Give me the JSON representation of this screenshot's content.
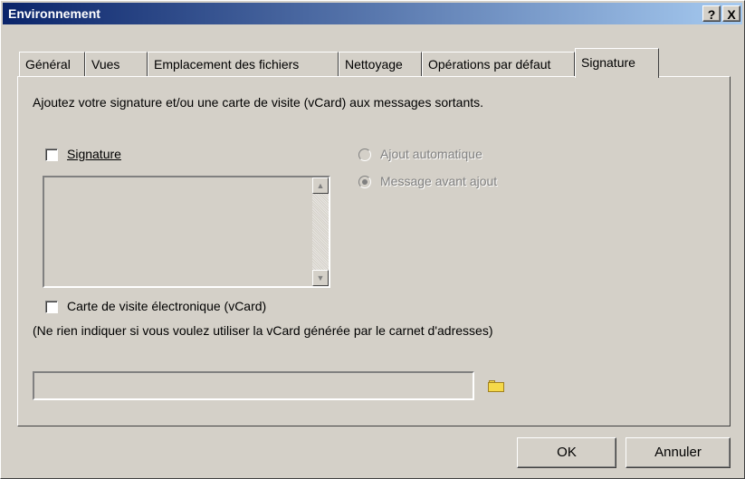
{
  "window": {
    "title": "Environnement",
    "help_label": "?",
    "close_label": "X"
  },
  "tabs": [
    {
      "label": "Général"
    },
    {
      "label": "Vues"
    },
    {
      "label": "Emplacement des fichiers"
    },
    {
      "label": "Nettoyage"
    },
    {
      "label": "Opérations par défaut"
    },
    {
      "label": "Signature"
    }
  ],
  "active_tab": "Signature",
  "signature_panel": {
    "description": "Ajoutez votre signature et/ou une carte de visite (vCard) aux messages sortants.",
    "signature_checkbox": {
      "label": "Signature",
      "checked": false
    },
    "radio_auto": {
      "label": "Ajout automatique",
      "checked": false,
      "disabled": true
    },
    "radio_before": {
      "label": "Message avant ajout",
      "checked": true,
      "disabled": true
    },
    "vcard_checkbox": {
      "label": "Carte de visite électronique (vCard)",
      "checked": false
    },
    "vcard_hint": "(Ne rien indiquer si vous voulez utiliser la vCard générée par le carnet d'adresses)",
    "vcard_path": ""
  },
  "buttons": {
    "ok": "OK",
    "cancel": "Annuler"
  },
  "icons": {
    "folder": "folder-icon",
    "scroll_up": "arrow-up-icon",
    "scroll_down": "arrow-down-icon"
  }
}
